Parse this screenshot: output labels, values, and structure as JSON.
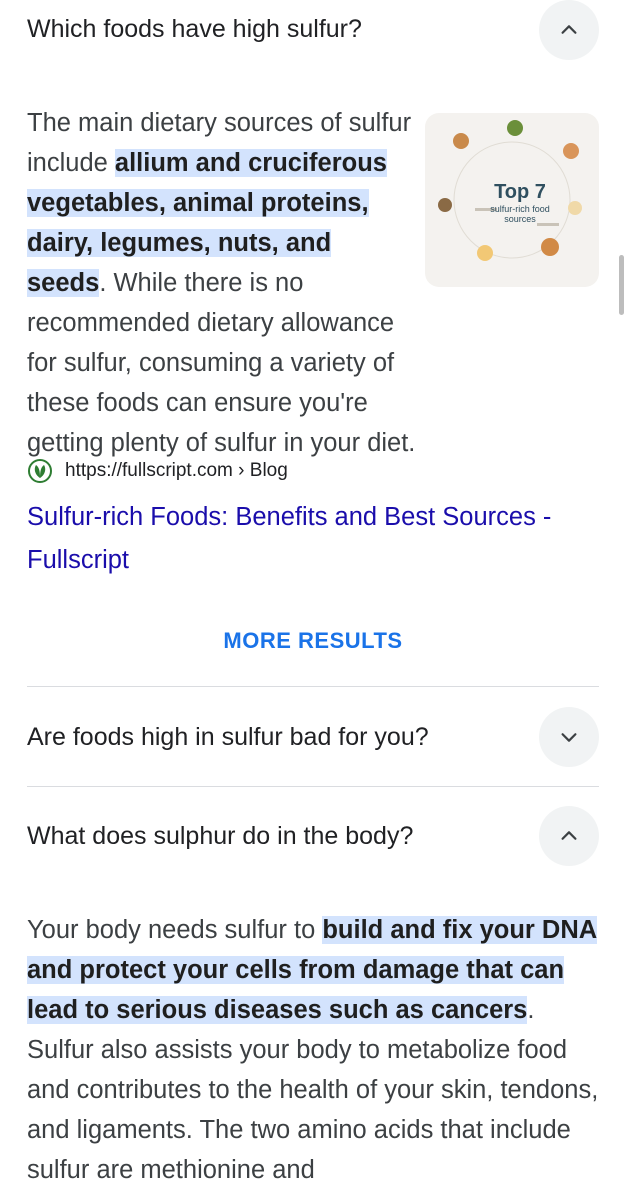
{
  "faq": [
    {
      "question": "Which foods have high sulfur?",
      "expanded": true,
      "answer_intro": "The main dietary sources of sulfur include ",
      "answer_highlight": "allium and cruciferous vegetables, animal proteins, dairy, legumes, nuts, and seeds",
      "answer_rest": ". While there is no recommended dietary allowance for sulfur, consuming a variety of these foods can ensure you're getting plenty of sulfur in your diet.",
      "thumbnail": {
        "title": "Top 7",
        "subtitle": "sulfur-rich food sources"
      },
      "source_url": "https://fullscript.com › Blog",
      "link_title": "Sulfur-rich Foods: Benefits and Best Sources - Fullscript"
    },
    {
      "question": "Are foods high in sulfur bad for you?",
      "expanded": false
    },
    {
      "question": "What does sulphur do in the body?",
      "expanded": true,
      "answer_intro": "Your body needs sulfur to ",
      "answer_highlight": "build and fix your DNA and protect your cells from damage that can lead to serious diseases such as cancers",
      "answer_rest": ". Sulfur also assists your body to metabolize food and contributes to the health of your skin, tendons, and ligaments. The two amino acids that include sulfur are methionine and"
    }
  ],
  "more_results_label": "MORE RESULTS",
  "colors": {
    "highlight": "#d3e3fd",
    "link": "#1a0dab",
    "button_text": "#1a73e8",
    "chevron_bg": "#f1f3f4",
    "brand_green": "#2e7d32"
  },
  "icons": {
    "chevron_up": "chevron-up-icon",
    "chevron_down": "chevron-down-icon",
    "site_logo": "fullscript-leaf-icon"
  }
}
